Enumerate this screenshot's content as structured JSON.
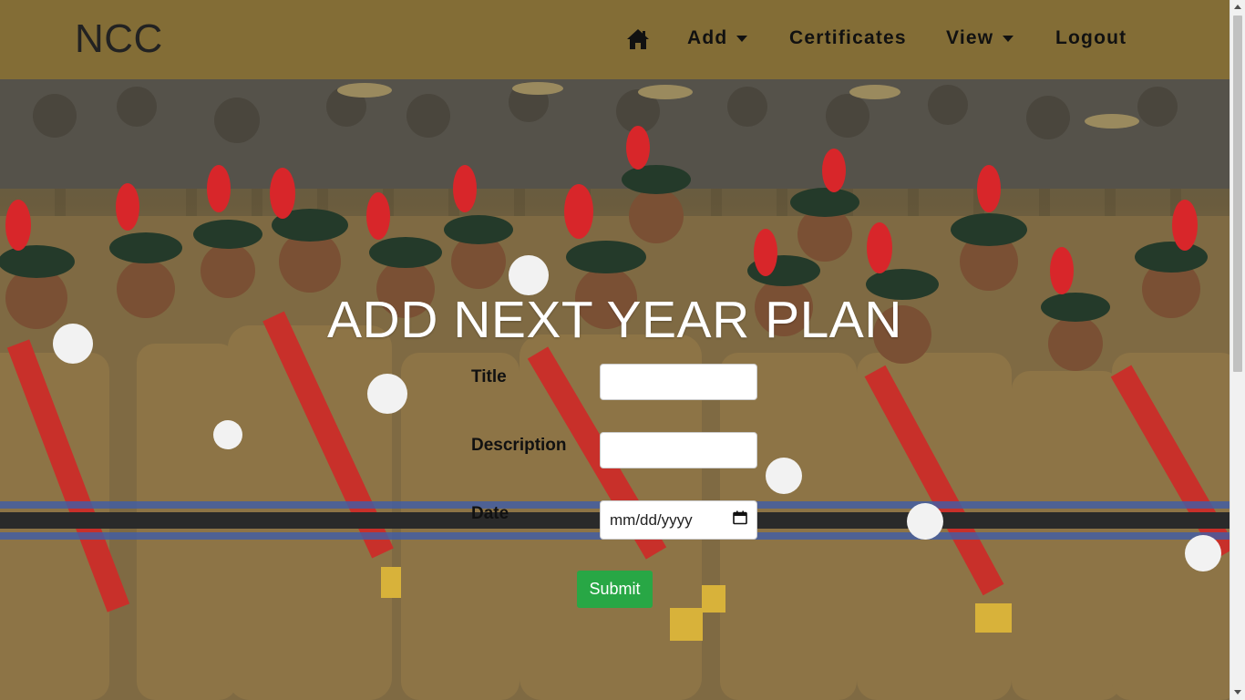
{
  "navbar": {
    "brand": "NCC",
    "home_icon": "home-icon",
    "items": [
      {
        "label": "Add",
        "dropdown": true
      },
      {
        "label": "Certificates",
        "dropdown": false
      },
      {
        "label": "View",
        "dropdown": true
      },
      {
        "label": "Logout",
        "dropdown": false
      }
    ],
    "background_color": "#836d36"
  },
  "form": {
    "title": "ADD NEXT YEAR PLAN",
    "fields": [
      {
        "label": "Title",
        "value": ""
      },
      {
        "label": "Description",
        "value": ""
      },
      {
        "label": "Date",
        "placeholder": "mm/dd/yyyy",
        "icon": "calendar-icon"
      }
    ],
    "submit_label": "Submit",
    "submit_color": "#28a745"
  },
  "background": {
    "image_description_icon": "parade-photo"
  }
}
